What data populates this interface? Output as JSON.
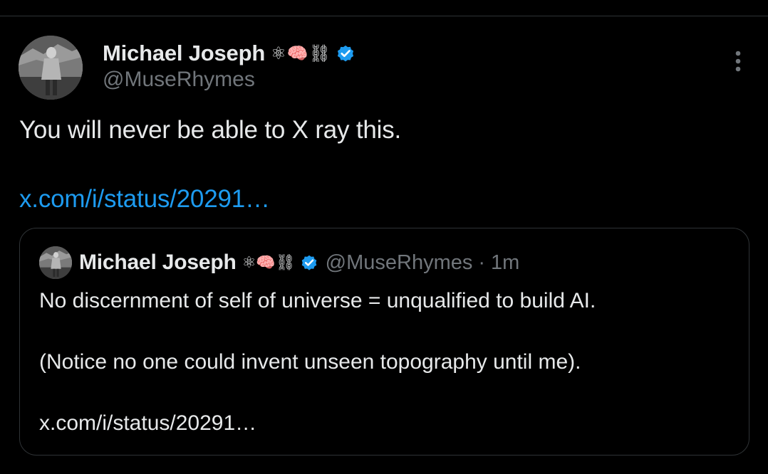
{
  "tweet": {
    "author": {
      "display_name": "Michael Joseph",
      "name_emoji": "⚛🧠⛓",
      "handle": "@MuseRhymes",
      "verified": true
    },
    "text": "You will never be able to X ray this.",
    "link": "x.com/i/status/20291…",
    "more_icon": "more-dots-vertical-icon"
  },
  "quote": {
    "author": {
      "display_name": "Michael Joseph",
      "name_emoji": "⚛🧠⛓",
      "handle": "@MuseRhymes",
      "verified": true
    },
    "separator": "·",
    "time": "1m",
    "lines": [
      "No discernment of self of universe = unqualified to build AI.",
      "(Notice no one could invent unseen topography until me).",
      "x.com/i/status/20291…"
    ]
  },
  "colors": {
    "background": "#000000",
    "text_primary": "#e7e9ea",
    "text_secondary": "#71767b",
    "link": "#1d9bf0",
    "border": "#2f3336",
    "verified_badge": "#1d9bf0"
  }
}
